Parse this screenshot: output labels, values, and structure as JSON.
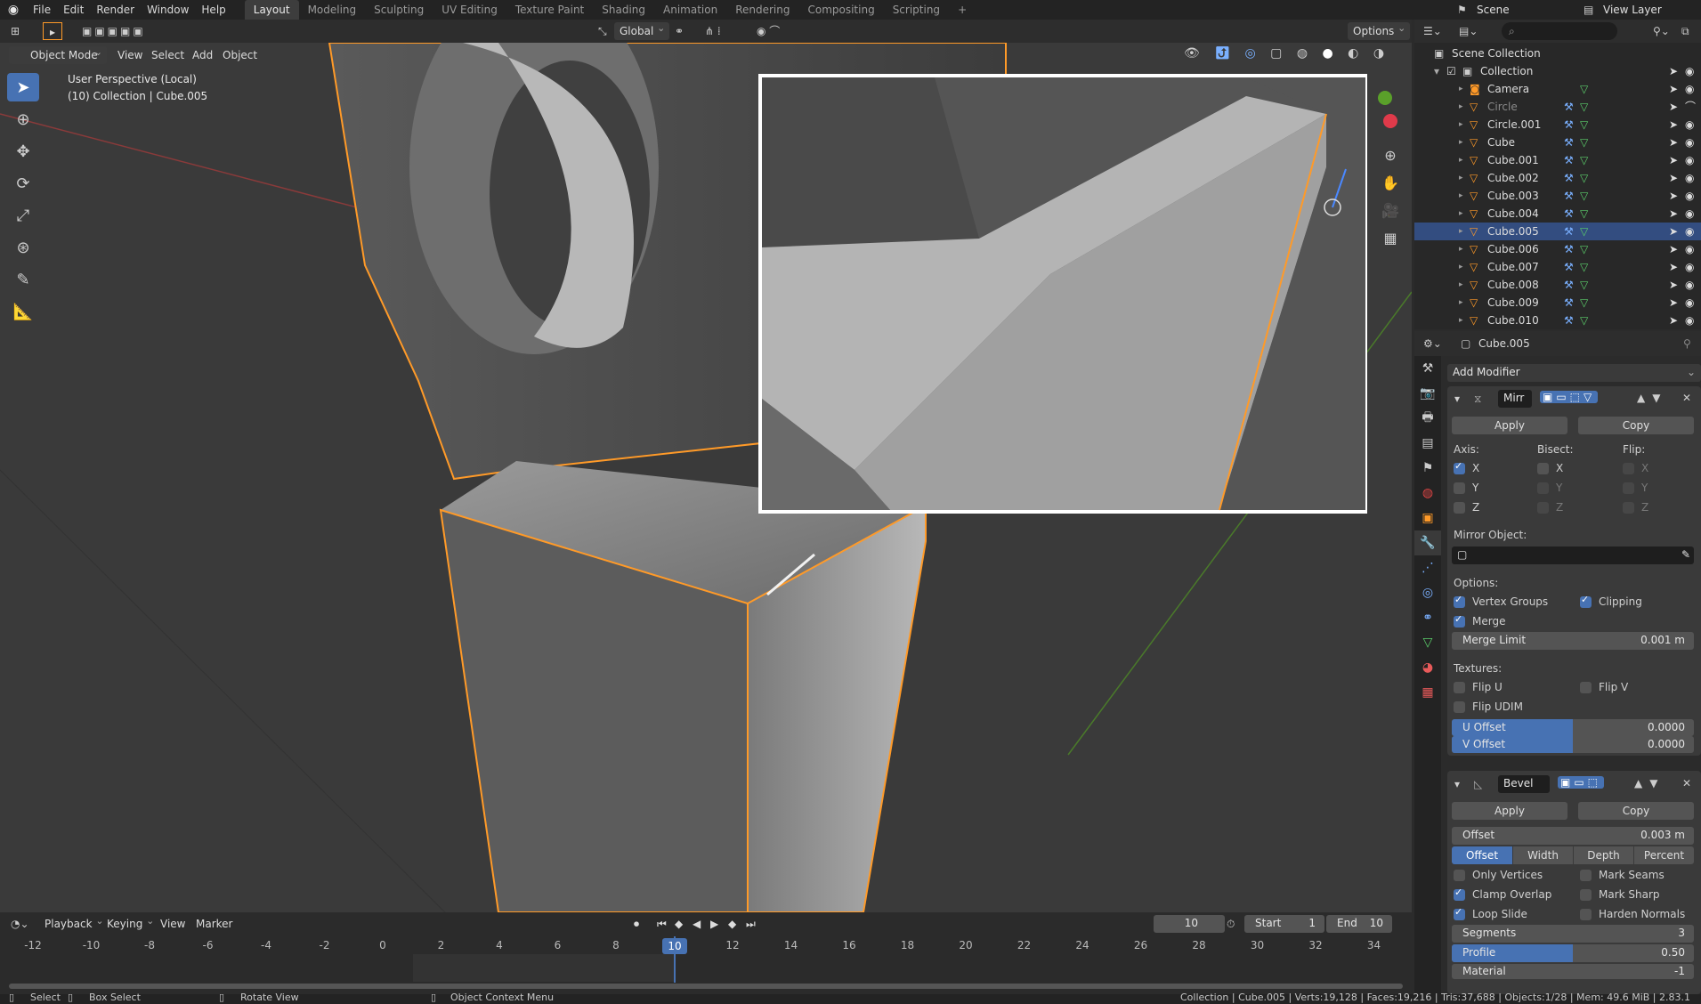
{
  "topbar": {
    "menus": [
      "File",
      "Edit",
      "Render",
      "Window",
      "Help"
    ],
    "workspaces": [
      "Layout",
      "Modeling",
      "Sculpting",
      "UV Editing",
      "Texture Paint",
      "Shading",
      "Animation",
      "Rendering",
      "Compositing",
      "Scripting"
    ],
    "active_workspace": "Layout",
    "scene_label": "Scene",
    "view_layer_label": "View Layer"
  },
  "viewport_header": {
    "transform_orientation": "Global",
    "options_label": "Options",
    "mode_label": "Object Mode",
    "menus": [
      "View",
      "Select",
      "Add",
      "Object"
    ]
  },
  "viewport": {
    "perspective_label": "User Perspective (Local)",
    "collection_label": "(10) Collection | Cube.005",
    "accent_color": "#ff9a28"
  },
  "outliner": {
    "root": "Scene Collection",
    "collection": "Collection",
    "items": [
      {
        "name": "Camera",
        "dim": false,
        "selected": false
      },
      {
        "name": "Circle",
        "dim": true,
        "selected": false
      },
      {
        "name": "Circle.001",
        "dim": false,
        "selected": false
      },
      {
        "name": "Cube",
        "dim": false,
        "selected": false
      },
      {
        "name": "Cube.001",
        "dim": false,
        "selected": false
      },
      {
        "name": "Cube.002",
        "dim": false,
        "selected": false
      },
      {
        "name": "Cube.003",
        "dim": false,
        "selected": false
      },
      {
        "name": "Cube.004",
        "dim": false,
        "selected": false
      },
      {
        "name": "Cube.005",
        "dim": false,
        "selected": true
      },
      {
        "name": "Cube.006",
        "dim": false,
        "selected": false
      },
      {
        "name": "Cube.007",
        "dim": false,
        "selected": false
      },
      {
        "name": "Cube.008",
        "dim": false,
        "selected": false
      },
      {
        "name": "Cube.009",
        "dim": false,
        "selected": false
      },
      {
        "name": "Cube.010",
        "dim": false,
        "selected": false
      }
    ]
  },
  "properties": {
    "object_name": "Cube.005",
    "add_modifier_label": "Add Modifier",
    "mirror": {
      "name": "Mirr",
      "apply_label": "Apply",
      "copy_label": "Copy",
      "axis_label": "Axis:",
      "bisect_label": "Bisect:",
      "flip_label": "Flip:",
      "axis": {
        "X": true,
        "Y": false,
        "Z": false
      },
      "bisect": {
        "X": false,
        "Y": false,
        "Z": false
      },
      "flip": {
        "X": false,
        "Y": false,
        "Z": false
      },
      "mirror_object_label": "Mirror Object:",
      "options_label": "Options:",
      "vertex_groups_label": "Vertex Groups",
      "vertex_groups": true,
      "clipping_label": "Clipping",
      "clipping": true,
      "merge_label": "Merge",
      "merge": true,
      "merge_limit_label": "Merge Limit",
      "merge_limit": "0.001 m",
      "textures_label": "Textures:",
      "flip_u_label": "Flip U",
      "flip_v_label": "Flip V",
      "flip_udim_label": "Flip UDIM",
      "u_offset_label": "U Offset",
      "u_offset": "0.0000",
      "v_offset_label": "V Offset",
      "v_offset": "0.0000"
    },
    "bevel": {
      "name": "Bevel",
      "apply_label": "Apply",
      "copy_label": "Copy",
      "offset_label": "Offset",
      "offset": "0.003 m",
      "modes": [
        "Offset",
        "Width",
        "Depth",
        "Percent"
      ],
      "active_mode": "Offset",
      "only_vertices_label": "Only Vertices",
      "only_vertices": false,
      "mark_seams_label": "Mark Seams",
      "mark_seams": false,
      "clamp_overlap_label": "Clamp Overlap",
      "clamp_overlap": true,
      "mark_sharp_label": "Mark Sharp",
      "mark_sharp": false,
      "loop_slide_label": "Loop Slide",
      "loop_slide": true,
      "harden_normals_label": "Harden Normals",
      "harden_normals": false,
      "segments_label": "Segments",
      "segments": "3",
      "profile_label": "Profile",
      "profile": "0.50",
      "profile_fraction": 0.5,
      "material_label": "Material",
      "material": "-1"
    }
  },
  "timeline": {
    "menus": [
      "Playback",
      "Keying",
      "View",
      "Marker"
    ],
    "current_frame": "10",
    "start_label": "Start",
    "start": "1",
    "end_label": "End",
    "end": "10",
    "ticks": [
      "-12",
      "-10",
      "-8",
      "-6",
      "-4",
      "-2",
      "0",
      "2",
      "4",
      "6",
      "8",
      "10",
      "12",
      "14",
      "16",
      "18",
      "20",
      "22",
      "24",
      "26",
      "28",
      "30",
      "32",
      "34"
    ]
  },
  "statusbar": {
    "select": "Select",
    "box_select": "Box Select",
    "rotate_view": "Rotate View",
    "context_menu": "Object Context Menu",
    "stats": "Collection | Cube.005 | Verts:19,128 | Faces:19,216 | Tris:37,688 | Objects:1/28 | Mem: 49.6 MiB | 2.83.1"
  }
}
